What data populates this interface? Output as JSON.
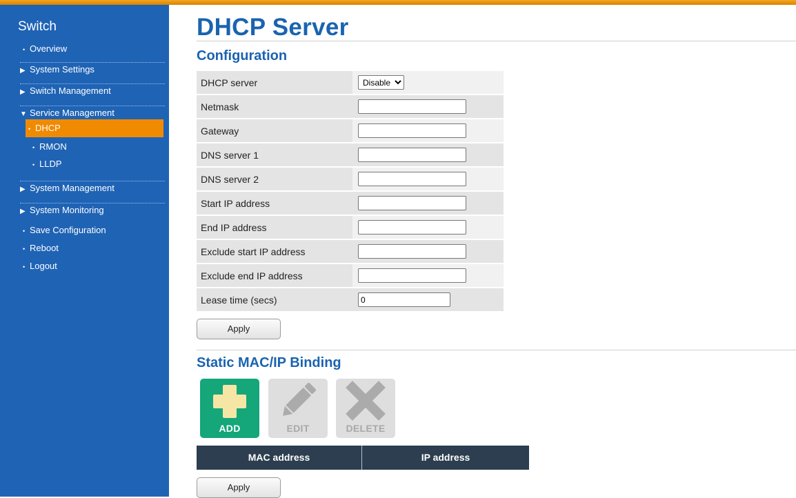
{
  "sidebar": {
    "title": "Switch",
    "items": [
      {
        "label": "Overview",
        "marker": "•"
      },
      {
        "label": "System Settings",
        "marker": "▶"
      },
      {
        "label": "Switch Management",
        "marker": "▶"
      },
      {
        "label": "Service Management",
        "marker": "▼"
      },
      {
        "label": "DHCP",
        "marker": "•"
      },
      {
        "label": "RMON",
        "marker": "•"
      },
      {
        "label": "LLDP",
        "marker": "•"
      },
      {
        "label": "System Management",
        "marker": "▶"
      },
      {
        "label": "System Monitoring",
        "marker": "▶"
      },
      {
        "label": "Save Configuration",
        "marker": "•"
      },
      {
        "label": "Reboot",
        "marker": "•"
      },
      {
        "label": "Logout",
        "marker": "•"
      }
    ],
    "active_item": "DHCP"
  },
  "page": {
    "title": "DHCP Server",
    "config_title": "Configuration",
    "static_title": "Static MAC/IP Binding"
  },
  "config": {
    "dhcp_server": {
      "label": "DHCP server",
      "value": "Disable",
      "options": [
        "Disable"
      ]
    },
    "netmask": {
      "label": "Netmask",
      "value": ""
    },
    "gateway": {
      "label": "Gateway",
      "value": ""
    },
    "dns1": {
      "label": "DNS server 1",
      "value": ""
    },
    "dns2": {
      "label": "DNS server 2",
      "value": ""
    },
    "start_ip": {
      "label": "Start IP address",
      "value": ""
    },
    "end_ip": {
      "label": "End IP address",
      "value": ""
    },
    "exclude_start": {
      "label": "Exclude start IP address",
      "value": ""
    },
    "exclude_end": {
      "label": "Exclude end IP address",
      "value": ""
    },
    "lease_time": {
      "label": "Lease time (secs)",
      "value": "0"
    }
  },
  "buttons": {
    "apply_label": "Apply",
    "add_label": "ADD",
    "edit_label": "EDIT",
    "delete_label": "DELETE"
  },
  "binding_table": {
    "columns": [
      "MAC address",
      "IP address"
    ]
  },
  "colors": {
    "sidebar": "#1f63b5",
    "active": "#f08a00",
    "title": "#1a63b0",
    "add_button": "#15a67a",
    "table_header": "#2c3e50"
  },
  "icons": {
    "add": "plus-icon",
    "edit": "pencil-icon",
    "delete": "x-icon"
  }
}
